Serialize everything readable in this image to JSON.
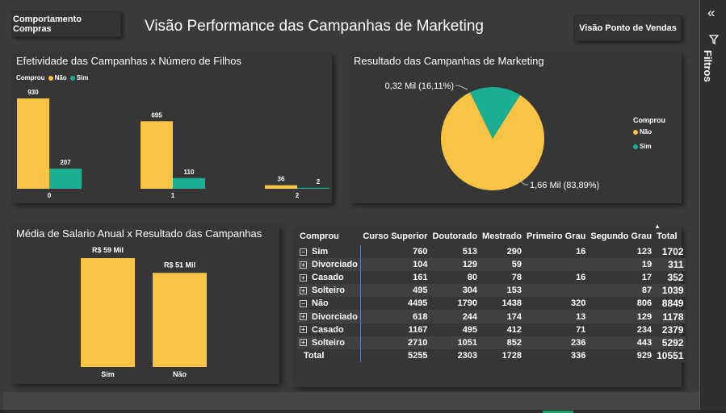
{
  "header": {
    "title": "Visão Performance das Campanhas de Marketing",
    "nav_left": "Comportamento Compras",
    "nav_right": "Visão Ponto de Vendas"
  },
  "colors": {
    "nao": "#f9c444",
    "sim": "#1aae93",
    "background": "#3b3b3b",
    "panel": "#363636"
  },
  "filters_pane": {
    "label": "Filtros",
    "collapse_icon": "double-chevron-left-icon",
    "filter_icon": "funnel-icon"
  },
  "chart_data": [
    {
      "type": "bar",
      "title": "Efetividade das Campanhas x Número de Filhos",
      "legend_title": "Comprou",
      "legend_position": "top-left",
      "categories": [
        "0",
        "1",
        "2"
      ],
      "series": [
        {
          "name": "Não",
          "values": [
            930,
            695,
            36
          ]
        },
        {
          "name": "Sim",
          "values": [
            207,
            110,
            2
          ]
        }
      ],
      "ylim": [
        0,
        930
      ]
    },
    {
      "type": "pie",
      "title": "Resultado das Campanhas de Marketing",
      "legend_title": "Comprou",
      "legend_position": "right",
      "slices": [
        {
          "name": "Não",
          "value": 1.66,
          "label": "1,66 Mil (83,89%)",
          "percent": 83.89
        },
        {
          "name": "Sim",
          "value": 0.32,
          "label": "0,32 Mil (16,11%)",
          "percent": 16.11
        }
      ]
    },
    {
      "type": "bar",
      "title": "Média de Salario Anual x Resultado das Campanhas",
      "categories": [
        "Sim",
        "Não"
      ],
      "values": [
        59,
        51
      ],
      "labels": [
        "R$ 59 Mil",
        "R$ 51 Mil"
      ],
      "ylim": [
        0,
        59
      ]
    }
  ],
  "matrix": {
    "columns": [
      "Comprou",
      "Curso Superior",
      "Doutorado",
      "Mestrado",
      "Primeiro Grau",
      "Segundo Grau",
      "Total"
    ],
    "sort_indicator": "▲",
    "rows": [
      {
        "label": "Sim",
        "level": 0,
        "expand": "⊟",
        "values": [
          "760",
          "513",
          "290",
          "16",
          "123",
          "1702"
        ]
      },
      {
        "label": "Divorciado",
        "level": 1,
        "expand": "⊞",
        "values": [
          "104",
          "129",
          "59",
          "",
          "19",
          "311"
        ]
      },
      {
        "label": "Casado",
        "level": 1,
        "expand": "⊞",
        "values": [
          "161",
          "80",
          "78",
          "16",
          "17",
          "352"
        ]
      },
      {
        "label": "Solteiro",
        "level": 1,
        "expand": "⊞",
        "values": [
          "495",
          "304",
          "153",
          "",
          "87",
          "1039"
        ]
      },
      {
        "label": "Não",
        "level": 0,
        "expand": "⊟",
        "values": [
          "4495",
          "1790",
          "1438",
          "320",
          "806",
          "8849"
        ]
      },
      {
        "label": "Divorciado",
        "level": 1,
        "expand": "⊞",
        "values": [
          "618",
          "244",
          "174",
          "13",
          "129",
          "1178"
        ]
      },
      {
        "label": "Casado",
        "level": 1,
        "expand": "⊞",
        "values": [
          "1167",
          "495",
          "412",
          "71",
          "234",
          "2379"
        ]
      },
      {
        "label": "Solteiro",
        "level": 1,
        "expand": "⊞",
        "values": [
          "2710",
          "1051",
          "852",
          "236",
          "443",
          "5292"
        ]
      }
    ],
    "total": {
      "label": "Total",
      "values": [
        "5255",
        "2303",
        "1728",
        "336",
        "929",
        "10551"
      ]
    }
  }
}
